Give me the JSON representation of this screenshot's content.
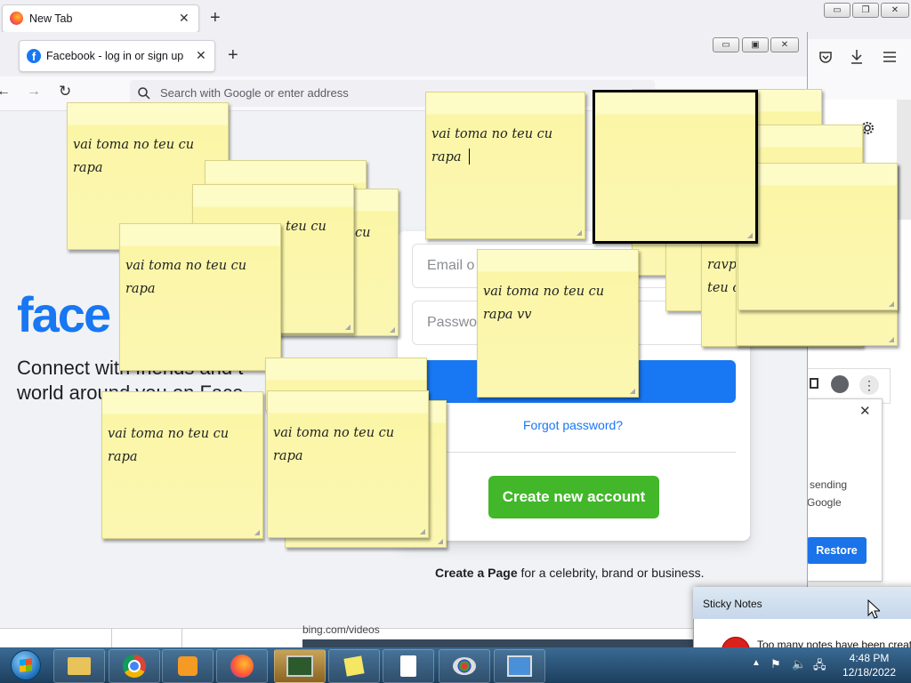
{
  "outer_browser": {
    "tab_title": "New Tab",
    "tab_close": "✕",
    "new_tab": "+",
    "window_buttons": {
      "minimize": "▭",
      "maximize": "❐",
      "close": "✕"
    }
  },
  "inner_browser": {
    "tab_title": "Facebook - log in or sign up",
    "tab_close": "✕",
    "new_tab": "+",
    "url_placeholder": "Search with Google or enter address",
    "window_buttons": {
      "minimize": "▭",
      "maximize": "▣",
      "close": "✕"
    }
  },
  "facebook": {
    "logo": "face",
    "tagline_line1": "Connect with friends and t",
    "tagline_line2": "world around you on Face",
    "email_placeholder": "Email o",
    "password_placeholder": "Passwo",
    "forgot_password": "Forgot password?",
    "create_account": "Create new account",
    "create_page_bold": "Create a Page",
    "create_page_rest": " for a celebrity, brand or business.",
    "footer_link": "bing.com/videos"
  },
  "side_popup": {
    "close": "✕",
    "line1": "sending",
    "line2": "Google",
    "restore": "Restore"
  },
  "sticky_notes": [
    {
      "text": "vai toma no teu cu rapa"
    },
    {
      "text": ""
    },
    {
      "text": "teu cu"
    },
    {
      "text": "cu"
    },
    {
      "text": "vai toma no teu cu rapa"
    },
    {
      "text": "vai toma no teu cu rapa "
    },
    {
      "text": ""
    },
    {
      "text": "vai toma no teu cu rapa vv"
    },
    {
      "text": "ravp"
    },
    {
      "text": "teu c"
    },
    {
      "text": "vai toma no teu cu rapa"
    },
    {
      "text": "vai toma no teu cu rapa"
    }
  ],
  "dialog": {
    "title": "Sticky Notes",
    "message": "Too many notes have been creat"
  },
  "taskbar": {
    "time": "4:48 PM",
    "date": "12/18/2022"
  }
}
